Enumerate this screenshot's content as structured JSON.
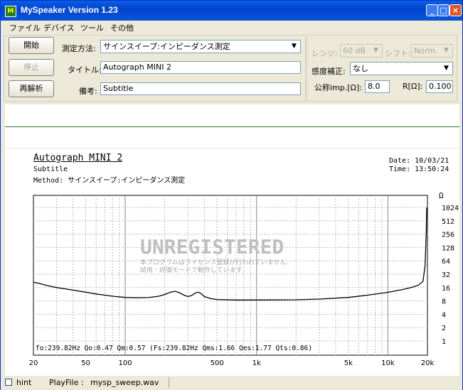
{
  "window": {
    "title": "MySpeaker Version 1.23",
    "icon_name": "app-icon",
    "controls": {
      "minimize": "_",
      "maximize": "□",
      "close": "×"
    }
  },
  "menu": [
    "ファイル",
    "デバイス",
    "ツール",
    "その他"
  ],
  "buttons": {
    "start": "開始",
    "stop": "停止",
    "reanalyze": "再解析"
  },
  "form": {
    "method_label": "測定方法:",
    "method_value": "サインスイープ:インピーダンス測定",
    "title_label": "タイトル:",
    "title_value": "Autograph MINI 2",
    "notes_label": "備考:",
    "notes_value": "Subtitle",
    "range_label": "レンジ:",
    "range_value": "60 dB",
    "shift_label": "シフト:",
    "shift_value": "Norm.",
    "sens_label": "感度補正:",
    "sens_value": "なし",
    "nominal_label": "公称imp.[Ω]:",
    "nominal_value": "8.0",
    "r_label": "R[Ω]:",
    "r_value": "0.100"
  },
  "plot": {
    "heading": "Autograph MINI 2",
    "subtitle": "Subtitle",
    "method_line": "Method:  サインスイープ:インピーダンス測定",
    "date_line": "Date: 10/03/21",
    "time_line": "Time: 13:50:24",
    "watermark": "UNREGISTERED",
    "watermark_sub1": "本プログラムはライセンス登録が行われていません.",
    "watermark_sub2": "試用・評価モードで動作しています.",
    "params_line": "fo:239.82Hz  Qo:0.47 Qm:0.57  (Fs:239.82Hz  Qms:1.66 Qes:1.77 Qts:0.86)",
    "y_unit": "Ω"
  },
  "chart_data": {
    "type": "line",
    "title": "Autograph MINI 2",
    "xlabel": "",
    "ylabel": "Ω",
    "x_scale": "log",
    "y_scale": "log2",
    "xlim": [
      20,
      20000
    ],
    "x_ticks": [
      "20",
      "50",
      "100",
      "500",
      "1k",
      "5k",
      "10k",
      "20k"
    ],
    "x_tick_values": [
      20,
      50,
      100,
      500,
      1000,
      5000,
      10000,
      20000
    ],
    "y_ticks": [
      "1024",
      "512",
      "256",
      "128",
      "64",
      "32",
      "16",
      "8",
      "4",
      "2",
      "1"
    ],
    "y_tick_values": [
      1024,
      512,
      256,
      128,
      64,
      32,
      16,
      8,
      4,
      2,
      1
    ],
    "grid": true,
    "series": [
      {
        "x": [
          20,
          22,
          25,
          30,
          35,
          40,
          50,
          60,
          70,
          80,
          100,
          120,
          150,
          180,
          200,
          220,
          240,
          260,
          280,
          300,
          320,
          340,
          360,
          380,
          400,
          450,
          500,
          700,
          1000,
          2000,
          3000,
          5000,
          7000,
          10000,
          13000,
          15000,
          17000,
          18500,
          19200,
          19600,
          20000
        ],
        "y": [
          21,
          20,
          18,
          16,
          15,
          14,
          12.6,
          11.5,
          10.8,
          10.2,
          9.6,
          9.4,
          9.5,
          10.2,
          11.2,
          12.5,
          13.2,
          12.2,
          10.8,
          10.0,
          10.6,
          12.0,
          12.6,
          11.6,
          10.0,
          9.0,
          8.6,
          8.4,
          8.4,
          8.5,
          8.8,
          9.6,
          10.8,
          12.5,
          14.5,
          16,
          18,
          22,
          50,
          300,
          1024
        ]
      }
    ]
  },
  "status": {
    "hint_label": "hint",
    "playfile_label": "PlayFile :",
    "playfile_value": "mysp_sweep.wav"
  }
}
